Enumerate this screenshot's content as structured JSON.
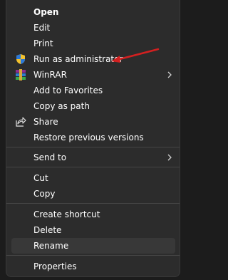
{
  "menu": {
    "items": [
      {
        "label": "Open",
        "bold": true
      },
      {
        "label": "Edit"
      },
      {
        "label": "Print"
      },
      {
        "label": "Run as administrator",
        "icon": "uac-shield-icon"
      },
      {
        "label": "WinRAR",
        "icon": "winrar-icon",
        "submenu": true
      },
      {
        "label": "Add to Favorites"
      },
      {
        "label": "Copy as path"
      },
      {
        "label": "Share",
        "icon": "share-icon"
      },
      {
        "label": "Restore previous versions"
      },
      {
        "label": "Send to",
        "submenu": true
      },
      {
        "label": "Cut"
      },
      {
        "label": "Copy"
      },
      {
        "label": "Create shortcut"
      },
      {
        "label": "Delete"
      },
      {
        "label": "Rename",
        "highlighted": true
      },
      {
        "label": "Properties"
      }
    ]
  },
  "colors": {
    "menu_background": "#2c2c2c",
    "text": "#ffffff",
    "highlight": "#383838",
    "separator": "#454545",
    "annotation_arrow": "#d32020"
  }
}
